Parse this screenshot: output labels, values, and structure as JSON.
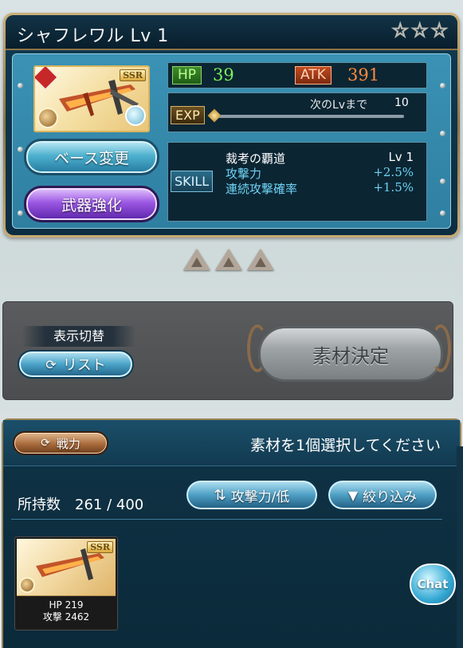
{
  "weapon": {
    "title": "シャフレワル Lv 1",
    "rarity": "SSR",
    "stars": [
      "☆",
      "☆",
      "☆"
    ],
    "hp_label": "HP",
    "hp": "39",
    "atk_label": "ATK",
    "atk": "391",
    "exp_label": "EXP",
    "next_level_label": "次のLvまで",
    "next_level_exp": "10",
    "exp_progress": 0.0,
    "skill_label": "SKILL",
    "skill_name": "裁考の覇道",
    "skill_level": "Lv 1",
    "skill_effects": [
      {
        "name": "攻撃力",
        "value": "+2.5%"
      },
      {
        "name": "連続攻撃確率",
        "value": "+1.5%"
      }
    ]
  },
  "buttons": {
    "change_base": "ベース変更",
    "upgrade_weapon": "武器強化",
    "list": "リスト",
    "confirm_material": "素材決定",
    "power": "戦力",
    "sort": "攻撃力/低",
    "filter": "絞り込み"
  },
  "display_toggle_label": "表示切替",
  "material": {
    "instruction": "素材を1個選択してください",
    "owned_count": "所持数　261 / 400"
  },
  "items": [
    {
      "rarity": "SSR",
      "hp_line": "HP  219",
      "atk_line": "攻撃 2462"
    }
  ],
  "chat_label": "Chat",
  "icons": {
    "star": "star-outline-icon",
    "uncap": "uncap-pyramid-icon",
    "refresh": "refresh-icon",
    "sort": "sort-arrows-icon",
    "filter": "funnel-icon"
  }
}
